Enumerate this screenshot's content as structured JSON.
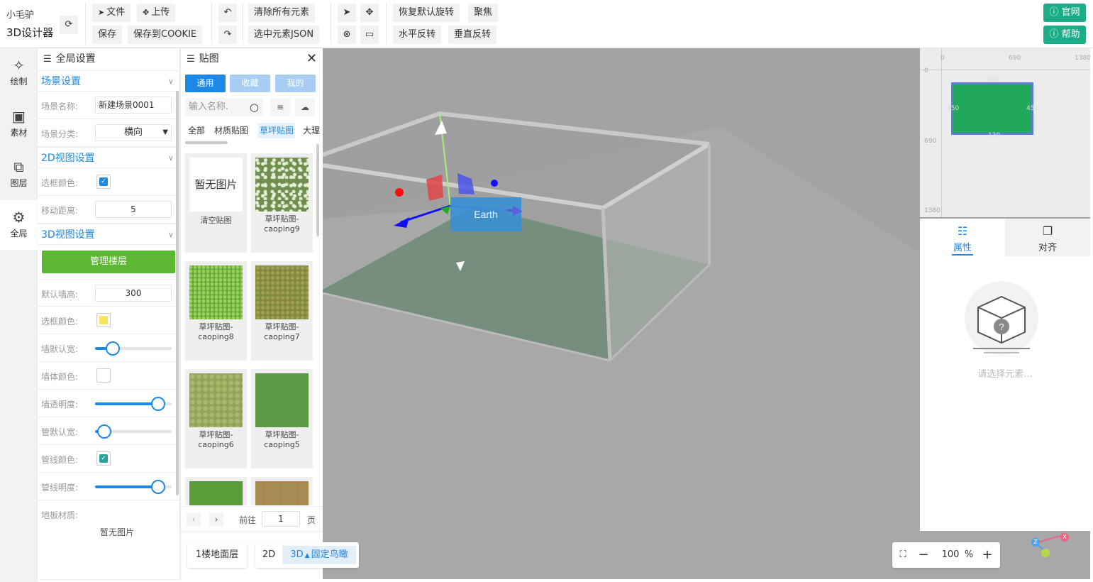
{
  "app": {
    "brand_top": "小毛驴",
    "brand_bottom": "3D设计器"
  },
  "toolbar": {
    "file": "文件",
    "upload": "上传",
    "save": "保存",
    "save_cookie": "保存到COOKIE",
    "clear_all": "清除所有元素",
    "selected_json": "选中元素JSON",
    "reset_rotation": "恢复默认旋转",
    "focus": "聚焦",
    "flip_h": "水平反转",
    "flip_v": "垂直反转",
    "website": "官网",
    "help": "帮助"
  },
  "nav": [
    {
      "label": "绘制",
      "icon": "magic-wand-icon"
    },
    {
      "label": "素材",
      "icon": "image-icon"
    },
    {
      "label": "图层",
      "icon": "layer-icon"
    },
    {
      "label": "全局",
      "icon": "gear-icon"
    }
  ],
  "global_panel": {
    "title": "全局设置",
    "scene": {
      "title": "场景设置",
      "name_label": "场景名称:",
      "name_value": "新建场景0001",
      "category_label": "场景分类:",
      "category_value": "横向"
    },
    "view2d": {
      "title": "2D视图设置",
      "frame_color_label": "选框颜色:",
      "frame_color": "#1e88e5",
      "move_label": "移动距离:",
      "move_value": "5"
    },
    "view3d": {
      "title": "3D视图设置",
      "manage_floors": "管理楼层",
      "wall_height_label": "默认墙高:",
      "wall_height_value": "300",
      "frame_color_label": "选框颜色:",
      "frame_color": "#f9e45a",
      "wall_width_label": "墙默认宽:",
      "wall_width_pct": 23,
      "wall_color_label": "墙体颜色:",
      "wall_color": "#ffffff",
      "wall_opacity_label": "墙透明度:",
      "wall_opacity_pct": 82,
      "pipe_width_label": "管默认宽:",
      "pipe_width_pct": 12,
      "pipe_color_label": "管线颜色:",
      "pipe_color": "#26a69a",
      "pipe_opacity_label": "管线明度:",
      "pipe_opacity_pct": 82,
      "floor_material_label": "地板材质:",
      "floor_material_value": "暂无图片"
    }
  },
  "texture_panel": {
    "title": "贴图",
    "tabs": [
      "通用",
      "收藏",
      "我的"
    ],
    "search_placeholder": "输入名称.",
    "categories": [
      "全部",
      "材质贴图",
      "草坪贴图",
      "大理"
    ],
    "items": [
      {
        "thumb_text": "暂无图片",
        "name": "清空贴图"
      },
      {
        "name": "草坪贴图-caoping9"
      },
      {
        "name": "草坪贴图-caoping8"
      },
      {
        "name": "草坪贴图-caoping7"
      },
      {
        "name": "草坪贴图-caoping6"
      },
      {
        "name": "草坪贴图-caoping5"
      }
    ],
    "pager": {
      "goto": "前往",
      "page": "1",
      "unit": "页"
    }
  },
  "viewport": {
    "label": "Earth"
  },
  "minimap": {
    "ticks_top": [
      "0",
      "690",
      "1380"
    ],
    "ticks_left": [
      "0",
      "690",
      "1380"
    ],
    "dims": [
      "350",
      "450",
      "450",
      "130"
    ]
  },
  "property_panel": {
    "tab_props": "属性",
    "tab_align": "对齐",
    "empty_text": "请选择元素..."
  },
  "bottom": {
    "floor": "1楼地面层",
    "mode_2d": "2D",
    "mode_3d": "3D",
    "fixed_view": "固定鸟瞰",
    "zoom": "100",
    "zoom_unit": "%",
    "axis_z": "Z",
    "axis_x": "X"
  }
}
